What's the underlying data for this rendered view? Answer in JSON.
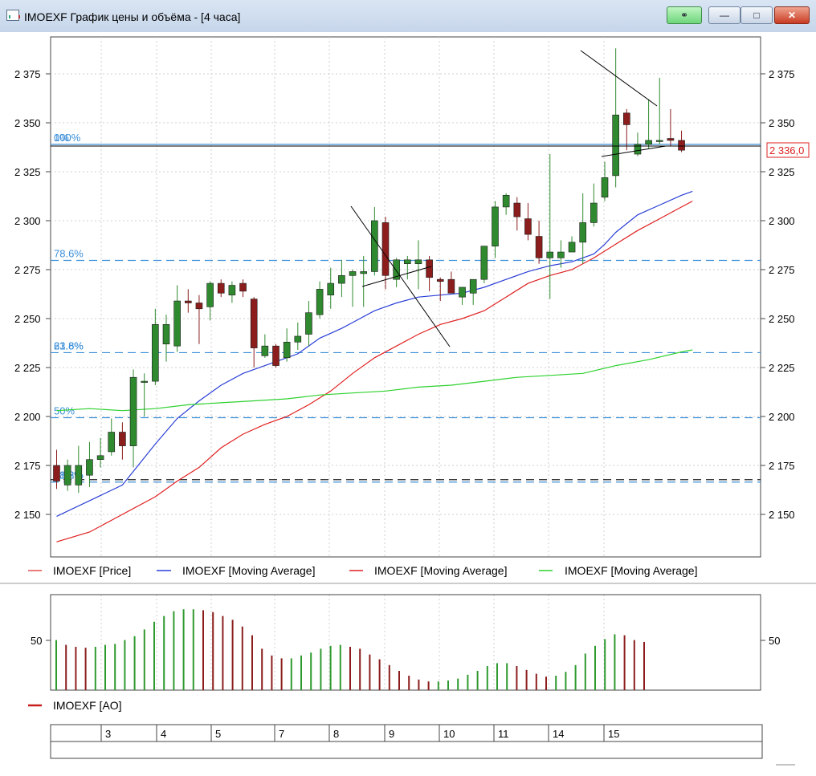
{
  "window": {
    "title": "IMOEXF График цены и объёма - [4 часа]",
    "controls": {
      "minimize": "—",
      "maximize": "□",
      "close": "✕",
      "link_icon": "link-icon"
    }
  },
  "price_axis": {
    "labels": [
      "2 375",
      "2 350",
      "2 325",
      "2 300",
      "2 275",
      "2 250",
      "2 225",
      "2 200",
      "2 175",
      "2 150"
    ],
    "current_price_label": "2 336,0"
  },
  "fib_levels": [
    {
      "label": "100%",
      "price": 2339
    },
    {
      "label": "0%",
      "price": 2339
    },
    {
      "label": "78.6%",
      "price": 2279.7
    },
    {
      "label": "61.8%",
      "price": 2232.6
    },
    {
      "label": "23.6%",
      "price": 2232.6
    },
    {
      "label": "50%",
      "price": 2199.4
    },
    {
      "label": "38.2%",
      "price": 2166.5
    },
    {
      "label": "61.8%",
      "price": 2166.5
    }
  ],
  "legend": [
    {
      "label": "IMOEXF [Price]",
      "color": "#e05050"
    },
    {
      "label": "IMOEXF [Moving Average]",
      "color": "#2a3fd6"
    },
    {
      "label": "IMOEXF [Moving Average]",
      "color": "#e02020"
    },
    {
      "label": "IMOEXF [Moving Average]",
      "color": "#2ed12e"
    }
  ],
  "ao_panel": {
    "axis_label": "50",
    "legend": {
      "label": "IMOEXF [AO]",
      "color": "#c81e1e"
    }
  },
  "date_axis": {
    "labels": [
      "3",
      "4",
      "5",
      "7",
      "8",
      "9",
      "10",
      "11",
      "14",
      "15"
    ]
  },
  "chart_data": {
    "type": "candlestick",
    "ylim": [
      2133,
      2401
    ],
    "candles": [
      {
        "o": 2175,
        "h": 2183,
        "l": 2163,
        "c": 2167
      },
      {
        "o": 2165,
        "h": 2178,
        "l": 2162,
        "c": 2175
      },
      {
        "o": 2165,
        "h": 2185,
        "l": 2161,
        "c": 2175
      },
      {
        "o": 2170,
        "h": 2187,
        "l": 2164,
        "c": 2178
      },
      {
        "o": 2178,
        "h": 2189,
        "l": 2174,
        "c": 2180
      },
      {
        "o": 2182,
        "h": 2199,
        "l": 2180,
        "c": 2192
      },
      {
        "o": 2192,
        "h": 2197,
        "l": 2178,
        "c": 2185
      },
      {
        "o": 2185,
        "h": 2224,
        "l": 2174,
        "c": 2220
      },
      {
        "o": 2218,
        "h": 2222,
        "l": 2200,
        "c": 2218
      },
      {
        "o": 2218,
        "h": 2255,
        "l": 2216,
        "c": 2247
      },
      {
        "o": 2237,
        "h": 2252,
        "l": 2228,
        "c": 2247
      },
      {
        "o": 2236,
        "h": 2267,
        "l": 2233,
        "c": 2259
      },
      {
        "o": 2259,
        "h": 2265,
        "l": 2253,
        "c": 2258
      },
      {
        "o": 2258,
        "h": 2262,
        "l": 2237,
        "c": 2255
      },
      {
        "o": 2256,
        "h": 2269,
        "l": 2249,
        "c": 2268
      },
      {
        "o": 2268,
        "h": 2270,
        "l": 2261,
        "c": 2263
      },
      {
        "o": 2262,
        "h": 2269,
        "l": 2258,
        "c": 2267
      },
      {
        "o": 2268,
        "h": 2270,
        "l": 2261,
        "c": 2264
      },
      {
        "o": 2260,
        "h": 2261,
        "l": 2225,
        "c": 2235
      },
      {
        "o": 2231,
        "h": 2242,
        "l": 2230,
        "c": 2236
      },
      {
        "o": 2236,
        "h": 2237,
        "l": 2225,
        "c": 2226
      },
      {
        "o": 2230,
        "h": 2245,
        "l": 2228,
        "c": 2238
      },
      {
        "o": 2238,
        "h": 2248,
        "l": 2234,
        "c": 2241
      },
      {
        "o": 2242,
        "h": 2259,
        "l": 2236,
        "c": 2253
      },
      {
        "o": 2252,
        "h": 2269,
        "l": 2250,
        "c": 2265
      },
      {
        "o": 2262,
        "h": 2276,
        "l": 2255,
        "c": 2268
      },
      {
        "o": 2268,
        "h": 2280,
        "l": 2261,
        "c": 2272
      },
      {
        "o": 2272,
        "h": 2275,
        "l": 2256,
        "c": 2274
      },
      {
        "o": 2273,
        "h": 2282,
        "l": 2256,
        "c": 2274
      },
      {
        "o": 2274,
        "h": 2307,
        "l": 2272,
        "c": 2300
      },
      {
        "o": 2299,
        "h": 2302,
        "l": 2265,
        "c": 2272
      },
      {
        "o": 2270,
        "h": 2281,
        "l": 2266,
        "c": 2280
      },
      {
        "o": 2278,
        "h": 2282,
        "l": 2270,
        "c": 2280
      },
      {
        "o": 2278,
        "h": 2290,
        "l": 2265,
        "c": 2280
      },
      {
        "o": 2280,
        "h": 2282,
        "l": 2264,
        "c": 2271
      },
      {
        "o": 2270,
        "h": 2271,
        "l": 2259,
        "c": 2269
      },
      {
        "o": 2270,
        "h": 2274,
        "l": 2263,
        "c": 2263
      },
      {
        "o": 2261,
        "h": 2266,
        "l": 2257,
        "c": 2266
      },
      {
        "o": 2263,
        "h": 2268,
        "l": 2257,
        "c": 2270
      },
      {
        "o": 2270,
        "h": 2287,
        "l": 2268,
        "c": 2287
      },
      {
        "o": 2287,
        "h": 2310,
        "l": 2281,
        "c": 2307
      },
      {
        "o": 2307,
        "h": 2314,
        "l": 2303,
        "c": 2313
      },
      {
        "o": 2309,
        "h": 2312,
        "l": 2295,
        "c": 2302
      },
      {
        "o": 2301,
        "h": 2309,
        "l": 2290,
        "c": 2293
      },
      {
        "o": 2292,
        "h": 2300,
        "l": 2278,
        "c": 2281
      },
      {
        "o": 2281,
        "h": 2334,
        "l": 2260,
        "c": 2284
      },
      {
        "o": 2281,
        "h": 2290,
        "l": 2276,
        "c": 2284
      },
      {
        "o": 2284,
        "h": 2292,
        "l": 2284,
        "c": 2289
      },
      {
        "o": 2289,
        "h": 2314,
        "l": 2278,
        "c": 2299
      },
      {
        "o": 2299,
        "h": 2319,
        "l": 2297,
        "c": 2309
      },
      {
        "o": 2312,
        "h": 2330,
        "l": 2310,
        "c": 2322
      },
      {
        "o": 2323,
        "h": 2388,
        "l": 2317,
        "c": 2354
      },
      {
        "o": 2355,
        "h": 2357,
        "l": 2336,
        "c": 2349
      },
      {
        "o": 2334,
        "h": 2345,
        "l": 2333,
        "c": 2339
      },
      {
        "o": 2339,
        "h": 2362,
        "l": 2337,
        "c": 2341
      },
      {
        "o": 2341,
        "h": 2373,
        "l": 2339,
        "c": 2341
      },
      {
        "o": 2342,
        "h": 2357,
        "l": 2338,
        "c": 2341
      },
      {
        "o": 2341,
        "h": 2346,
        "l": 2335,
        "c": 2336
      }
    ],
    "moving_averages": [
      {
        "color": "#2a3fd6",
        "points": [
          [
            0,
            2149
          ],
          [
            3,
            2157
          ],
          [
            6,
            2165
          ],
          [
            9,
            2186
          ],
          [
            11,
            2199
          ],
          [
            13,
            2208
          ],
          [
            15,
            2216
          ],
          [
            17,
            2222
          ],
          [
            18,
            2224
          ],
          [
            20,
            2228
          ],
          [
            22,
            2232
          ],
          [
            24,
            2240
          ],
          [
            26,
            2245
          ],
          [
            27,
            2248
          ],
          [
            29,
            2254
          ],
          [
            31,
            2258
          ],
          [
            33,
            2261
          ],
          [
            35,
            2262
          ],
          [
            37,
            2263
          ],
          [
            39,
            2266
          ],
          [
            41,
            2270
          ],
          [
            43,
            2274
          ],
          [
            45,
            2277
          ],
          [
            47,
            2279
          ],
          [
            49,
            2283
          ],
          [
            50,
            2288
          ],
          [
            51,
            2294
          ],
          [
            53,
            2303
          ],
          [
            55,
            2308
          ],
          [
            57,
            2313
          ],
          [
            58,
            2315
          ]
        ]
      },
      {
        "color": "#e02020",
        "points": [
          [
            0,
            2136
          ],
          [
            3,
            2141
          ],
          [
            6,
            2150
          ],
          [
            9,
            2159
          ],
          [
            11,
            2167
          ],
          [
            13,
            2174
          ],
          [
            15,
            2184
          ],
          [
            17,
            2191
          ],
          [
            19,
            2196
          ],
          [
            21,
            2200
          ],
          [
            23,
            2206
          ],
          [
            25,
            2213
          ],
          [
            27,
            2222
          ],
          [
            29,
            2230
          ],
          [
            31,
            2236
          ],
          [
            33,
            2242
          ],
          [
            35,
            2247
          ],
          [
            37,
            2250
          ],
          [
            39,
            2254
          ],
          [
            41,
            2261
          ],
          [
            43,
            2268
          ],
          [
            45,
            2272
          ],
          [
            47,
            2275
          ],
          [
            49,
            2281
          ],
          [
            51,
            2288
          ],
          [
            53,
            2295
          ],
          [
            55,
            2301
          ],
          [
            57,
            2307
          ],
          [
            58,
            2310
          ]
        ]
      },
      {
        "color": "#2ed12e",
        "points": [
          [
            0,
            2203
          ],
          [
            3,
            2204
          ],
          [
            6,
            2203
          ],
          [
            9,
            2204
          ],
          [
            12,
            2206
          ],
          [
            15,
            2207
          ],
          [
            18,
            2208
          ],
          [
            21,
            2209
          ],
          [
            24,
            2211
          ],
          [
            27,
            2212
          ],
          [
            30,
            2213
          ],
          [
            33,
            2215
          ],
          [
            36,
            2216
          ],
          [
            39,
            2218
          ],
          [
            42,
            2220
          ],
          [
            45,
            2221
          ],
          [
            48,
            2222
          ],
          [
            51,
            2226
          ],
          [
            54,
            2229
          ],
          [
            57,
            2233
          ],
          [
            58,
            2234
          ]
        ]
      }
    ],
    "ao": {
      "ylim": [
        -15,
        95
      ],
      "values": [
        52,
        47,
        45,
        44,
        45,
        47,
        48,
        52,
        56,
        63,
        71,
        77,
        82,
        84,
        84,
        83,
        81,
        77,
        73,
        66,
        57,
        43,
        36,
        33,
        33,
        36,
        39,
        43,
        46,
        47,
        45,
        43,
        37,
        32,
        26,
        20,
        15,
        11,
        9,
        9,
        10,
        12,
        16,
        20,
        25,
        28,
        28,
        25,
        21,
        17,
        14,
        15,
        19,
        26,
        38,
        46,
        53,
        58,
        57,
        52,
        50
      ]
    }
  }
}
